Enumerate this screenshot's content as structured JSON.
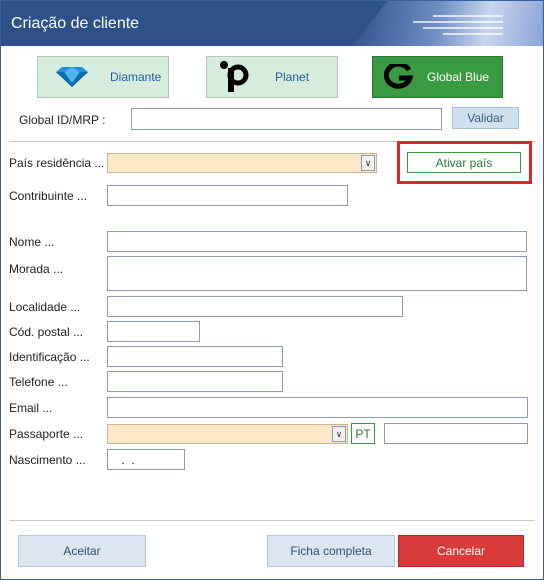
{
  "window": {
    "title": "Criação de cliente"
  },
  "brands": [
    {
      "label": "Diamante",
      "icon": "diamond-icon"
    },
    {
      "label": "Planet",
      "icon": "planet-p-icon"
    },
    {
      "label": "Global Blue",
      "icon": "global-blue-g-icon"
    }
  ],
  "global_id": {
    "label": "Global ID/MRP :",
    "value": "",
    "button": "Validar"
  },
  "form": {
    "pais_residencia": {
      "label": "País residência ...",
      "value": ""
    },
    "ativar_pais": {
      "label": "Ativar país"
    },
    "contribuinte": {
      "label": "Contribuinte ...",
      "value": ""
    },
    "nome": {
      "label": "Nome ...",
      "value": ""
    },
    "morada": {
      "label": "Morada ...",
      "value": ""
    },
    "localidade": {
      "label": "Localidade ...",
      "value": ""
    },
    "cod_postal": {
      "label": "Cód. postal ...",
      "value": ""
    },
    "identificacao": {
      "label": "Identificação ...",
      "value": ""
    },
    "telefone": {
      "label": "Telefone ...",
      "value": ""
    },
    "email": {
      "label": "Email ...",
      "value": ""
    },
    "passaporte": {
      "label": "Passaporte ...",
      "country_code": "PT",
      "number": ""
    },
    "nascimento": {
      "label": "Nascimento ...",
      "value": " .  ."
    }
  },
  "footer": {
    "accept": "Aceitar",
    "full": "Ficha completa",
    "cancel": "Cancelar"
  },
  "colors": {
    "title_bar": "#2e5189",
    "brand_bg": "#d6ecdc",
    "global_blue": "#3a9a42",
    "cancel": "#d93a3a",
    "highlight_border": "#e0262b",
    "required_field": "#fde8c8"
  }
}
